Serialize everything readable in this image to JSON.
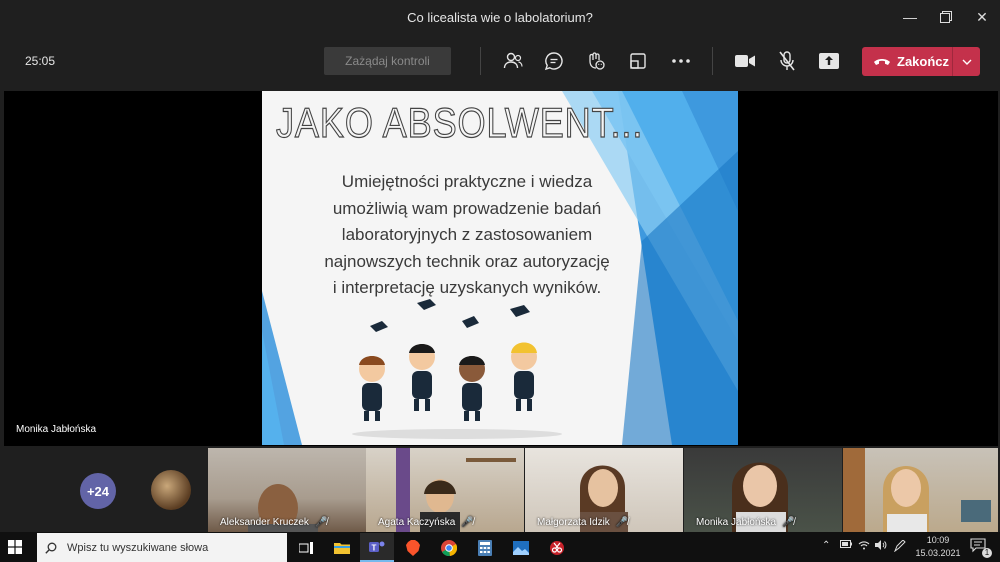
{
  "window": {
    "title": "Co licealista wie o labolatorium?"
  },
  "toolbar": {
    "timer": "25:05",
    "request_control_label": "Zażądaj kontroli",
    "end_label": "Zakończ"
  },
  "slide": {
    "title": "JAKO ABSOLWENT...",
    "body_lines": [
      "Umiejętności praktyczne i wiedza",
      "umożliwią wam prowadzenie badań",
      "laboratoryjnych z zastosowaniem",
      "najnowszych technik oraz autoryzację",
      "i interpretację uzyskanych wyników."
    ]
  },
  "presenter": {
    "name": "Monika Jabłońska"
  },
  "participants": {
    "overflow_count": "+24",
    "tiles": [
      {
        "name": "Aleksander Kruczek",
        "muted": true
      },
      {
        "name": "Agata Kaczyńska",
        "muted": true
      },
      {
        "name": "Małgorzata Idzik",
        "muted": true
      },
      {
        "name": "Monika Jabłońska",
        "muted": true
      },
      {
        "name": "",
        "muted": false
      }
    ]
  },
  "taskbar": {
    "search_placeholder": "Wpisz tu wyszukiwane słowa",
    "time": "10:09",
    "date": "15.03.2021",
    "notification_count": "1"
  },
  "colors": {
    "end_call": "#c4314b",
    "teams_accent": "#6264a7",
    "slide_blue": "#2a8fdc"
  }
}
